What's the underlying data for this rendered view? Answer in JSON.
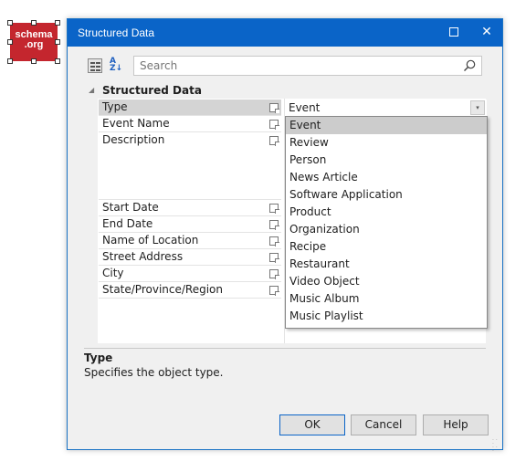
{
  "logo": {
    "line1": "schema",
    "line2": ".org",
    "color": "#c4262e"
  },
  "dialog": {
    "title": "Structured Data",
    "accent": "#0a64c8",
    "maximize_icon": "maximize-icon",
    "close_glyph": "✕"
  },
  "toolbar": {
    "categorized_icon": "categorized-icon",
    "sort_icon": "sort-az-icon",
    "sort_glyph_top": "A",
    "sort_glyph_bottom": "Z↓",
    "search_placeholder": "Search",
    "search_value": ""
  },
  "grid": {
    "group_label": "Structured Data",
    "group_arrow": "◢",
    "properties": [
      {
        "name": "Type"
      },
      {
        "name": "Event Name"
      },
      {
        "name": "Description"
      },
      {
        "name": "Start Date"
      },
      {
        "name": "End Date"
      },
      {
        "name": "Name of Location"
      },
      {
        "name": "Street Address"
      },
      {
        "name": "City"
      },
      {
        "name": "State/Province/Region"
      }
    ],
    "type_value": "Event",
    "combo_glyph": "▾"
  },
  "dropdown": {
    "selected": "Event",
    "options": [
      "Event",
      "Review",
      "Person",
      "News Article",
      "Software Application",
      "Product",
      "Organization",
      "Recipe",
      "Restaurant",
      "Video Object",
      "Music Album",
      "Music Playlist"
    ]
  },
  "description": {
    "title": "Type",
    "text": "Specifies the object type."
  },
  "buttons": {
    "ok": "OK",
    "cancel": "Cancel",
    "help": "Help"
  }
}
